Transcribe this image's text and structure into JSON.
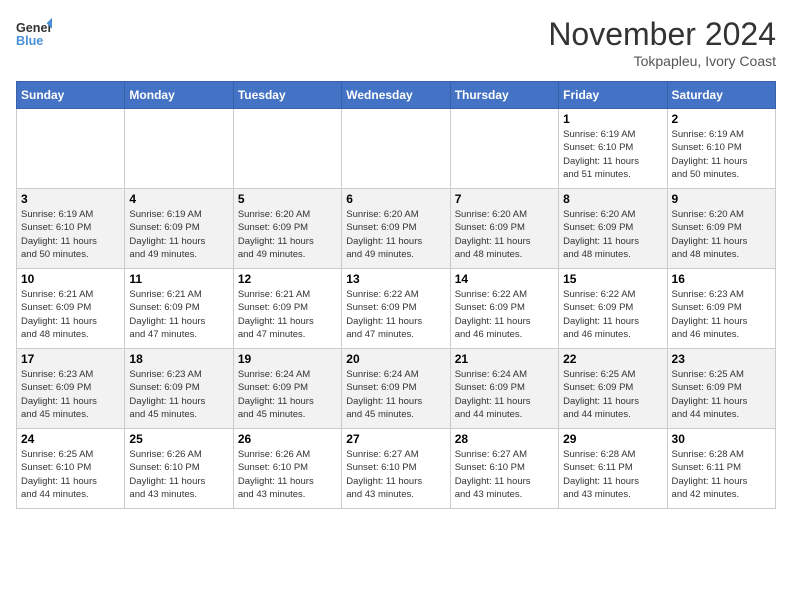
{
  "header": {
    "logo_line1": "General",
    "logo_line2": "Blue",
    "month_title": "November 2024",
    "location": "Tokpapleu, Ivory Coast"
  },
  "weekdays": [
    "Sunday",
    "Monday",
    "Tuesday",
    "Wednesday",
    "Thursday",
    "Friday",
    "Saturday"
  ],
  "weeks": [
    [
      {
        "day": "",
        "info": ""
      },
      {
        "day": "",
        "info": ""
      },
      {
        "day": "",
        "info": ""
      },
      {
        "day": "",
        "info": ""
      },
      {
        "day": "",
        "info": ""
      },
      {
        "day": "1",
        "info": "Sunrise: 6:19 AM\nSunset: 6:10 PM\nDaylight: 11 hours\nand 51 minutes."
      },
      {
        "day": "2",
        "info": "Sunrise: 6:19 AM\nSunset: 6:10 PM\nDaylight: 11 hours\nand 50 minutes."
      }
    ],
    [
      {
        "day": "3",
        "info": "Sunrise: 6:19 AM\nSunset: 6:10 PM\nDaylight: 11 hours\nand 50 minutes."
      },
      {
        "day": "4",
        "info": "Sunrise: 6:19 AM\nSunset: 6:09 PM\nDaylight: 11 hours\nand 49 minutes."
      },
      {
        "day": "5",
        "info": "Sunrise: 6:20 AM\nSunset: 6:09 PM\nDaylight: 11 hours\nand 49 minutes."
      },
      {
        "day": "6",
        "info": "Sunrise: 6:20 AM\nSunset: 6:09 PM\nDaylight: 11 hours\nand 49 minutes."
      },
      {
        "day": "7",
        "info": "Sunrise: 6:20 AM\nSunset: 6:09 PM\nDaylight: 11 hours\nand 48 minutes."
      },
      {
        "day": "8",
        "info": "Sunrise: 6:20 AM\nSunset: 6:09 PM\nDaylight: 11 hours\nand 48 minutes."
      },
      {
        "day": "9",
        "info": "Sunrise: 6:20 AM\nSunset: 6:09 PM\nDaylight: 11 hours\nand 48 minutes."
      }
    ],
    [
      {
        "day": "10",
        "info": "Sunrise: 6:21 AM\nSunset: 6:09 PM\nDaylight: 11 hours\nand 48 minutes."
      },
      {
        "day": "11",
        "info": "Sunrise: 6:21 AM\nSunset: 6:09 PM\nDaylight: 11 hours\nand 47 minutes."
      },
      {
        "day": "12",
        "info": "Sunrise: 6:21 AM\nSunset: 6:09 PM\nDaylight: 11 hours\nand 47 minutes."
      },
      {
        "day": "13",
        "info": "Sunrise: 6:22 AM\nSunset: 6:09 PM\nDaylight: 11 hours\nand 47 minutes."
      },
      {
        "day": "14",
        "info": "Sunrise: 6:22 AM\nSunset: 6:09 PM\nDaylight: 11 hours\nand 46 minutes."
      },
      {
        "day": "15",
        "info": "Sunrise: 6:22 AM\nSunset: 6:09 PM\nDaylight: 11 hours\nand 46 minutes."
      },
      {
        "day": "16",
        "info": "Sunrise: 6:23 AM\nSunset: 6:09 PM\nDaylight: 11 hours\nand 46 minutes."
      }
    ],
    [
      {
        "day": "17",
        "info": "Sunrise: 6:23 AM\nSunset: 6:09 PM\nDaylight: 11 hours\nand 45 minutes."
      },
      {
        "day": "18",
        "info": "Sunrise: 6:23 AM\nSunset: 6:09 PM\nDaylight: 11 hours\nand 45 minutes."
      },
      {
        "day": "19",
        "info": "Sunrise: 6:24 AM\nSunset: 6:09 PM\nDaylight: 11 hours\nand 45 minutes."
      },
      {
        "day": "20",
        "info": "Sunrise: 6:24 AM\nSunset: 6:09 PM\nDaylight: 11 hours\nand 45 minutes."
      },
      {
        "day": "21",
        "info": "Sunrise: 6:24 AM\nSunset: 6:09 PM\nDaylight: 11 hours\nand 44 minutes."
      },
      {
        "day": "22",
        "info": "Sunrise: 6:25 AM\nSunset: 6:09 PM\nDaylight: 11 hours\nand 44 minutes."
      },
      {
        "day": "23",
        "info": "Sunrise: 6:25 AM\nSunset: 6:09 PM\nDaylight: 11 hours\nand 44 minutes."
      }
    ],
    [
      {
        "day": "24",
        "info": "Sunrise: 6:25 AM\nSunset: 6:10 PM\nDaylight: 11 hours\nand 44 minutes."
      },
      {
        "day": "25",
        "info": "Sunrise: 6:26 AM\nSunset: 6:10 PM\nDaylight: 11 hours\nand 43 minutes."
      },
      {
        "day": "26",
        "info": "Sunrise: 6:26 AM\nSunset: 6:10 PM\nDaylight: 11 hours\nand 43 minutes."
      },
      {
        "day": "27",
        "info": "Sunrise: 6:27 AM\nSunset: 6:10 PM\nDaylight: 11 hours\nand 43 minutes."
      },
      {
        "day": "28",
        "info": "Sunrise: 6:27 AM\nSunset: 6:10 PM\nDaylight: 11 hours\nand 43 minutes."
      },
      {
        "day": "29",
        "info": "Sunrise: 6:28 AM\nSunset: 6:11 PM\nDaylight: 11 hours\nand 43 minutes."
      },
      {
        "day": "30",
        "info": "Sunrise: 6:28 AM\nSunset: 6:11 PM\nDaylight: 11 hours\nand 42 minutes."
      }
    ]
  ]
}
